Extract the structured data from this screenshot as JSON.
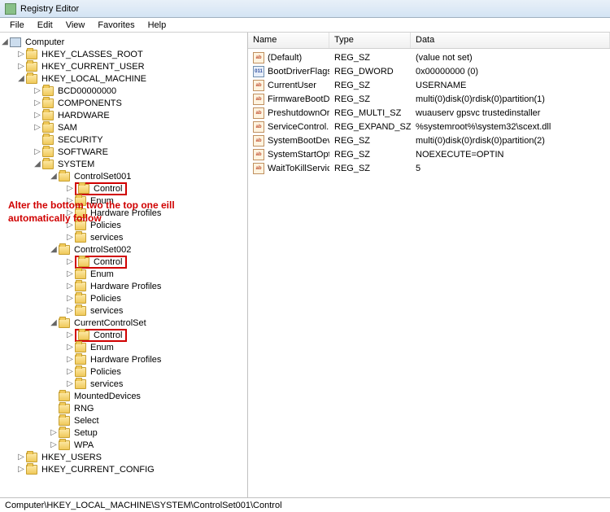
{
  "window": {
    "title": "Registry Editor"
  },
  "menu": {
    "file": "File",
    "edit": "Edit",
    "view": "View",
    "favorites": "Favorites",
    "help": "Help"
  },
  "tree": {
    "root": "Computer",
    "hkcr": "HKEY_CLASSES_ROOT",
    "hkcu": "HKEY_CURRENT_USER",
    "hklm": "HKEY_LOCAL_MACHINE",
    "bcd": "BCD00000000",
    "comp": "COMPONENTS",
    "hw": "HARDWARE",
    "sam": "SAM",
    "sec": "SECURITY",
    "sw": "SOFTWARE",
    "sys": "SYSTEM",
    "cs1": "ControlSet001",
    "cs2": "ControlSet002",
    "ccs": "CurrentControlSet",
    "ctrl": "Control",
    "enum": "Enum",
    "hwp": "Hardware Profiles",
    "pol": "Policies",
    "svc": "services",
    "md": "MountedDevices",
    "rng": "RNG",
    "sel": "Select",
    "setup": "Setup",
    "wpa": "WPA",
    "hku": "HKEY_USERS",
    "hkcc": "HKEY_CURRENT_CONFIG"
  },
  "list": {
    "headers": {
      "name": "Name",
      "type": "Type",
      "data": "Data"
    },
    "rows": [
      {
        "icon": "str",
        "name": "(Default)",
        "type": "REG_SZ",
        "data": "(value not set)"
      },
      {
        "icon": "bin",
        "name": "BootDriverFlags",
        "type": "REG_DWORD",
        "data": "0x00000000 (0)"
      },
      {
        "icon": "str",
        "name": "CurrentUser",
        "type": "REG_SZ",
        "data": "USERNAME"
      },
      {
        "icon": "str",
        "name": "FirmwareBootD...",
        "type": "REG_SZ",
        "data": "multi(0)disk(0)rdisk(0)partition(1)"
      },
      {
        "icon": "str",
        "name": "PreshutdownOr...",
        "type": "REG_MULTI_SZ",
        "data": "wuauserv gpsvc trustedinstaller"
      },
      {
        "icon": "str",
        "name": "ServiceControl...",
        "type": "REG_EXPAND_SZ",
        "data": "%systemroot%\\system32\\scext.dll"
      },
      {
        "icon": "str",
        "name": "SystemBootDevi...",
        "type": "REG_SZ",
        "data": "multi(0)disk(0)rdisk(0)partition(2)"
      },
      {
        "icon": "str",
        "name": "SystemStartOpti...",
        "type": "REG_SZ",
        "data": " NOEXECUTE=OPTIN"
      },
      {
        "icon": "str",
        "name": "WaitToKillServic...",
        "type": "REG_SZ",
        "data": "5"
      }
    ]
  },
  "annotation": {
    "line1": "Alter the bottom two the top one eill",
    "line2": "automatically follow"
  },
  "statusbar": {
    "path": "Computer\\HKEY_LOCAL_MACHINE\\SYSTEM\\ControlSet001\\Control"
  }
}
